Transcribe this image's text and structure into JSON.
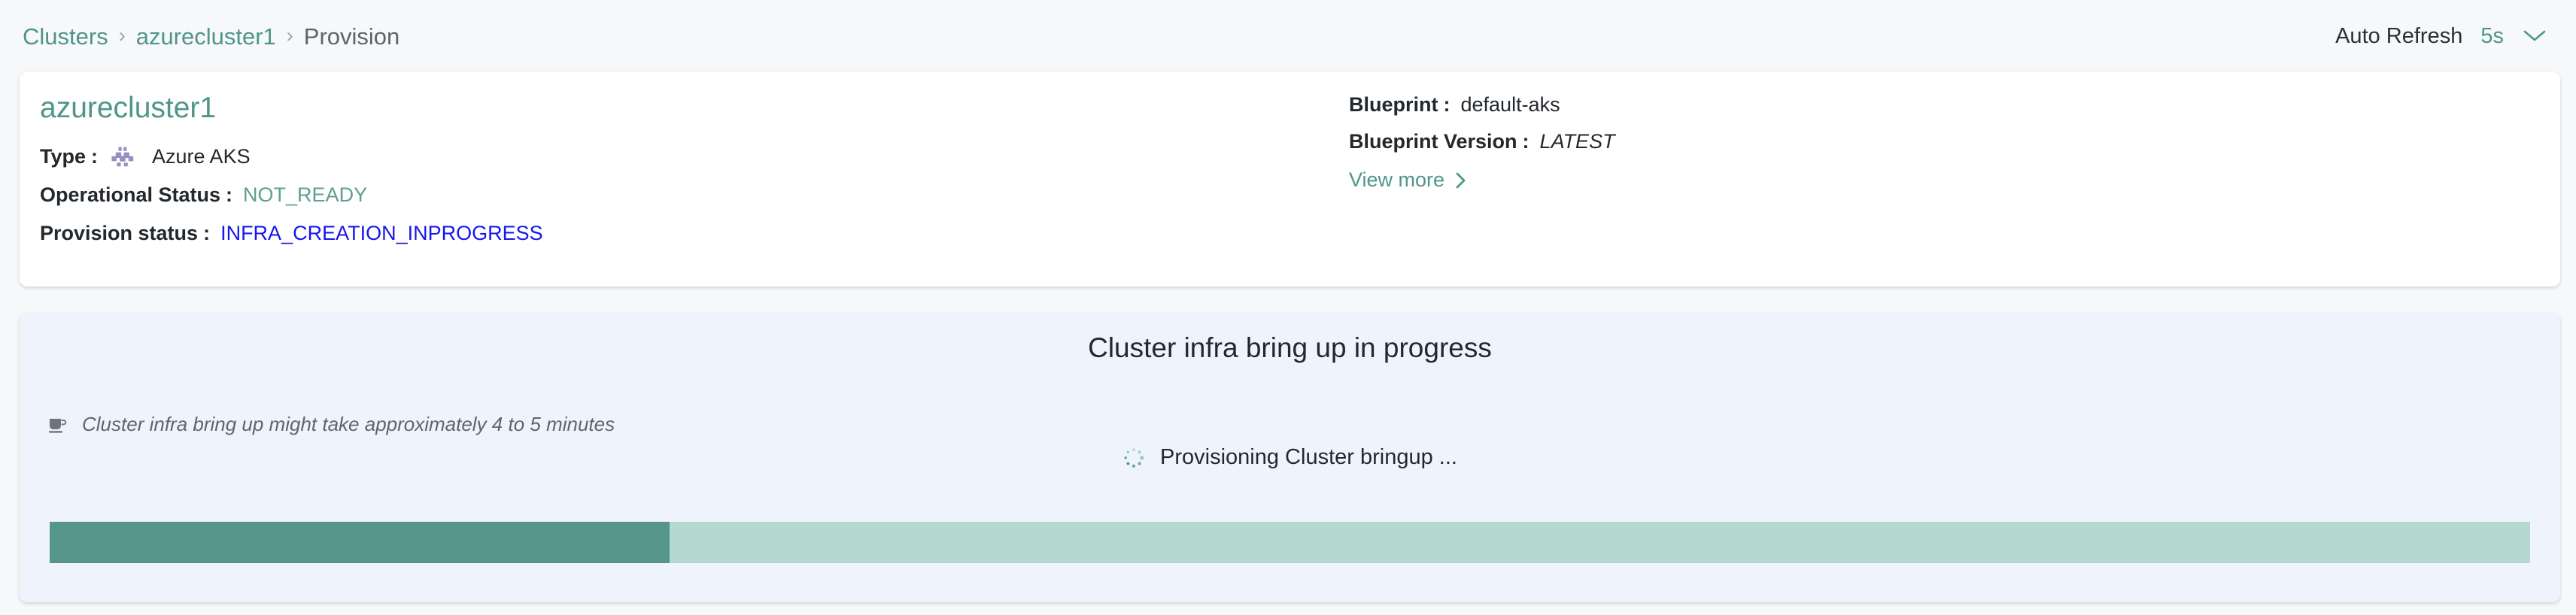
{
  "breadcrumb": {
    "items": [
      {
        "label": "Clusters",
        "current": false
      },
      {
        "label": "azurecluster1",
        "current": false
      },
      {
        "label": "Provision",
        "current": true
      }
    ],
    "separator": "›"
  },
  "auto_refresh": {
    "label": "Auto Refresh",
    "interval": "5s",
    "chevron_icon": "chevron-down-icon"
  },
  "summary": {
    "cluster_name": "azurecluster1",
    "type_label": "Type",
    "type_icon": "azure-aks-icon",
    "type_value": "Azure AKS",
    "operational_status_label": "Operational Status",
    "operational_status_value": "NOT_READY",
    "provision_status_label": "Provision status",
    "provision_status_value": "INFRA_CREATION_INPROGRESS",
    "blueprint_label": "Blueprint",
    "blueprint_value": "default-aks",
    "blueprint_version_label": "Blueprint Version",
    "blueprint_version_value": "LATEST",
    "view_more_label": "View more",
    "view_more_icon": "chevron-right-icon",
    "colon": ":"
  },
  "progress": {
    "heading": "Cluster infra bring up in progress",
    "hint_icon": "coffee-cup-icon",
    "hint_text": "Cluster infra bring up might take approximately 4 to 5 minutes",
    "spinner_icon": "loading-spinner-icon",
    "status_text": "Provisioning Cluster bringup ...",
    "percent": 25
  },
  "colors": {
    "page_background": "#f7f8fa",
    "card_background": "#ffffff",
    "panel_background": "#eff4fc",
    "accent_teal": "#4f958a",
    "status_blue": "#1616ee",
    "status_teal": "#5f9e92",
    "progress_fill": "#569589",
    "progress_track": "#b4d9d0",
    "aks_icon_purple": "#9b8ec4"
  }
}
